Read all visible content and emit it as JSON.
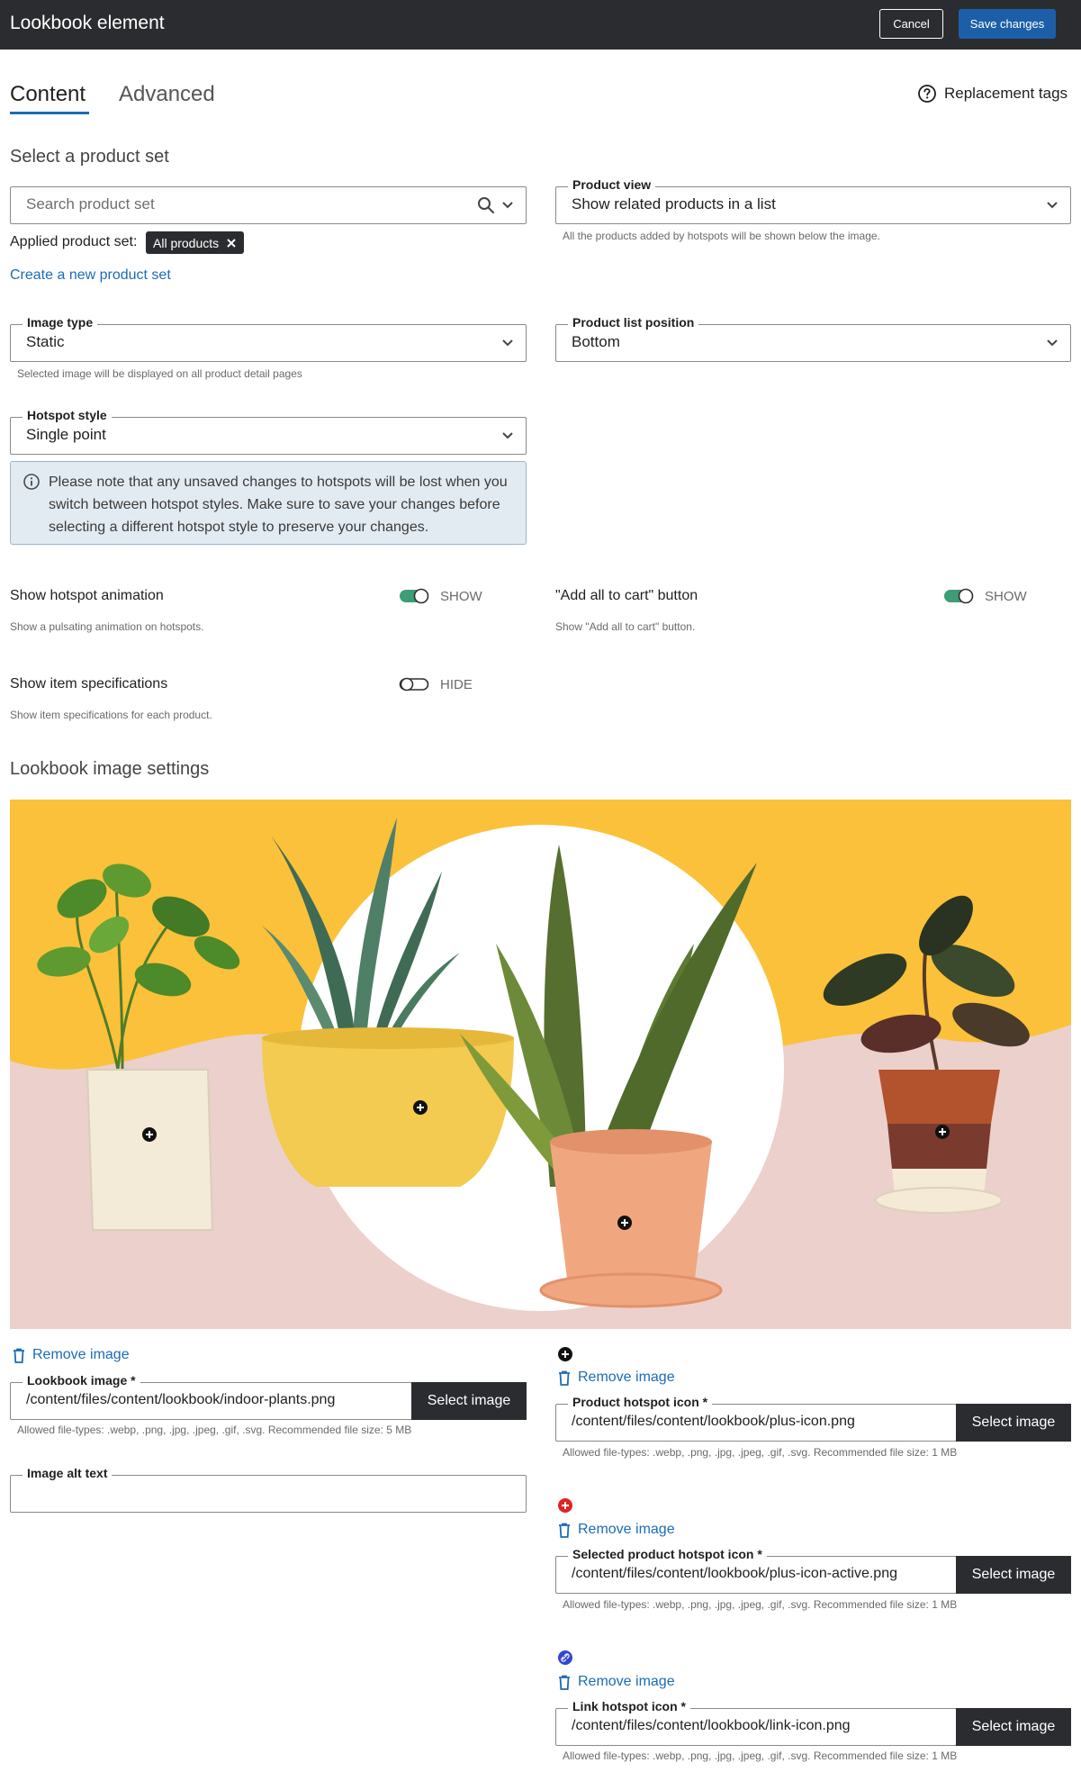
{
  "header": {
    "title": "Lookbook element",
    "cancel_label": "Cancel",
    "save_label": "Save changes"
  },
  "tabs": {
    "content": "Content",
    "advanced": "Advanced",
    "replacement_tags": "Replacement tags"
  },
  "product_set": {
    "heading": "Select a product set",
    "search_placeholder": "Search product set",
    "applied_label": "Applied product set:",
    "applied_chip": "All products",
    "create_link": "Create a new product set"
  },
  "product_view": {
    "label": "Product view",
    "value": "Show related products in a list",
    "help": "All the products added by hotspots will be shown below the image."
  },
  "image_type": {
    "label": "Image type",
    "value": "Static",
    "help": "Selected image will be displayed on all product detail pages"
  },
  "product_list_position": {
    "label": "Product list position",
    "value": "Bottom"
  },
  "hotspot_style": {
    "label": "Hotspot style",
    "value": "Single point",
    "notice": "Please note that any unsaved changes to hotspots will be lost when you switch between hotspot styles. Make sure to save your changes before selecting a different hotspot style to preserve your changes."
  },
  "toggles": {
    "hotspot_animation": {
      "label": "Show hotspot animation",
      "state": "SHOW",
      "on": true,
      "help": "Show a pulsating animation on hotspots."
    },
    "add_all_to_cart": {
      "label": "\"Add all to cart\" button",
      "state": "SHOW",
      "on": true,
      "help": "Show \"Add all to cart\" button."
    },
    "item_specs": {
      "label": "Show item specifications",
      "state": "HIDE",
      "on": false,
      "help": "Show item specifications for each product."
    }
  },
  "image_settings": {
    "heading": "Lookbook image settings",
    "remove_label": "Remove image",
    "lookbook_image": {
      "label": "Lookbook image *",
      "value": "/content/files/content/lookbook/indoor-plants.png",
      "button": "Select image",
      "help": "Allowed file-types: .webp, .png, .jpg, .jpeg, .gif, .svg. Recommended file size: 5 MB"
    },
    "alt_text": {
      "label": "Image alt text",
      "value": ""
    },
    "product_hotspot_icon": {
      "remove_label": "Remove image",
      "label": "Product hotspot icon *",
      "value": "/content/files/content/lookbook/plus-icon.png",
      "button": "Select image",
      "help": "Allowed file-types: .webp, .png, .jpg, .jpeg, .gif, .svg. Recommended file size: 1 MB"
    },
    "selected_hotspot_icon": {
      "remove_label": "Remove image",
      "label": "Selected product hotspot icon *",
      "value": "/content/files/content/lookbook/plus-icon-active.png",
      "button": "Select image",
      "help": "Allowed file-types: .webp, .png, .jpg, .jpeg, .gif, .svg. Recommended file size: 1 MB"
    },
    "link_hotspot_icon": {
      "remove_label": "Remove image",
      "label": "Link hotspot icon *",
      "value": "/content/files/content/lookbook/link-icon.png",
      "button": "Select image",
      "help": "Allowed file-types: .webp, .png, .jpg, .jpeg, .gif, .svg. Recommended file size: 1 MB"
    }
  },
  "colors": {
    "topbar": "#2b2c30",
    "primary": "#1c5fa8",
    "link": "#1c6cb7",
    "toggle_on": "#3c9d76",
    "banner_yellow": "#fbc13a",
    "banner_pink": "#ecd0cb"
  }
}
